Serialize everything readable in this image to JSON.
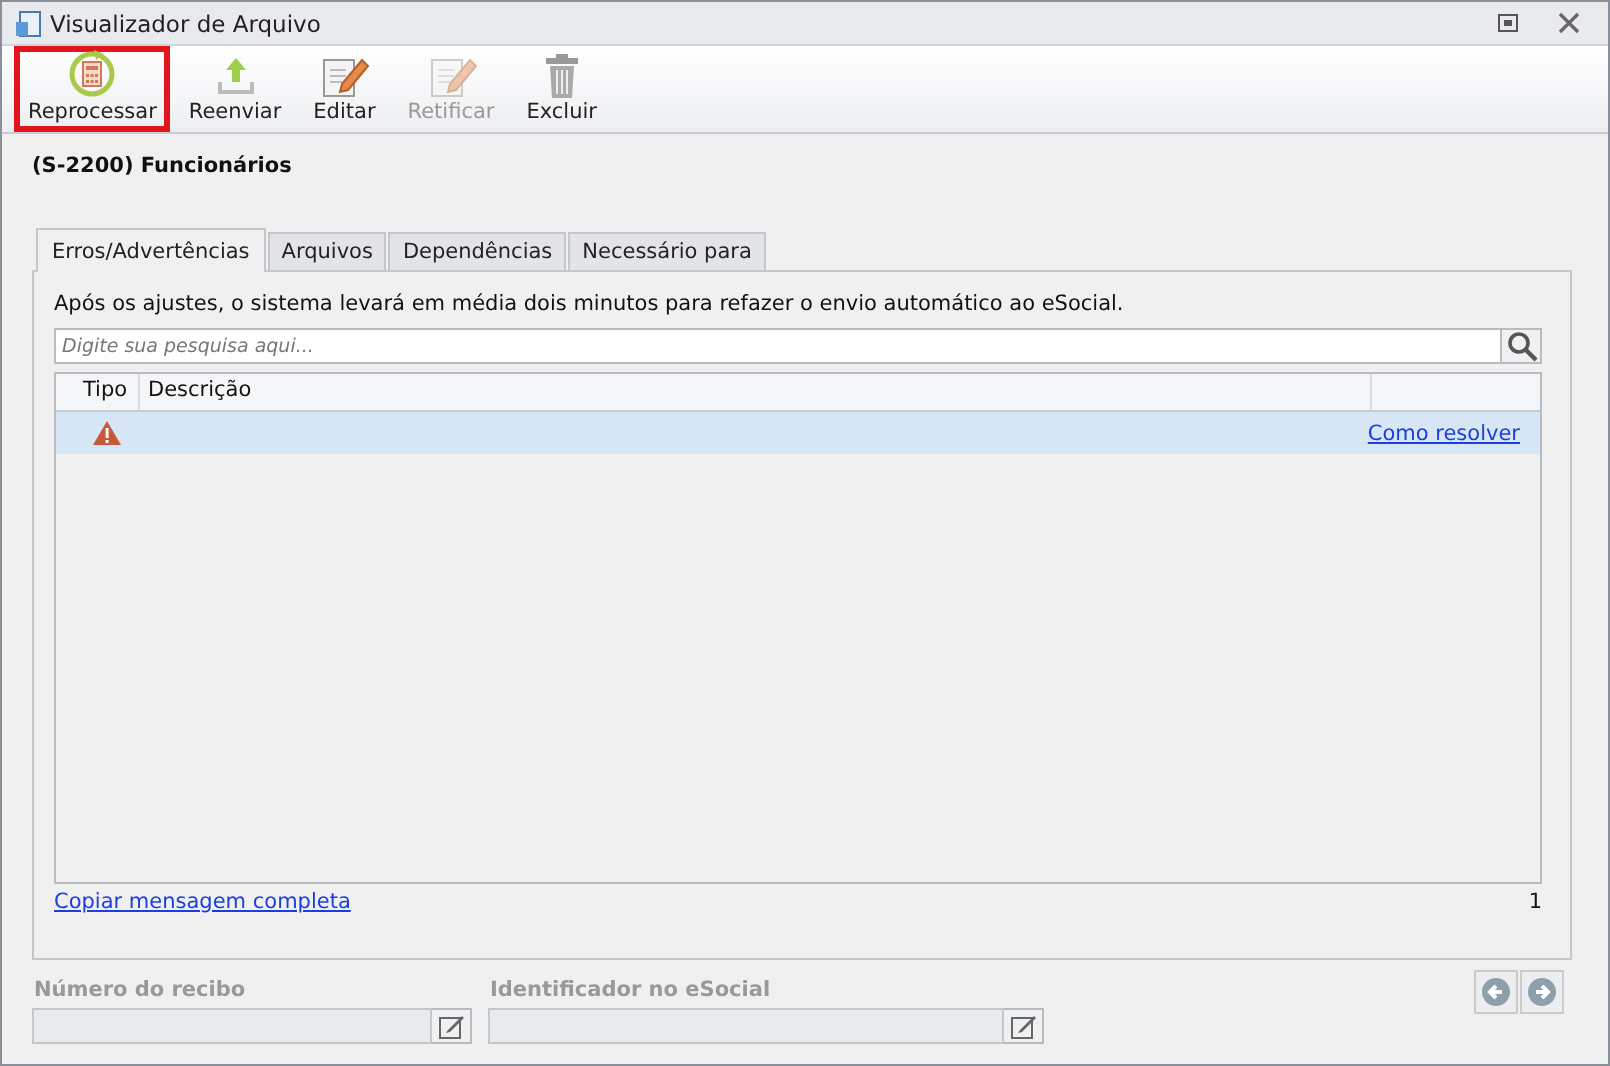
{
  "window": {
    "title": "Visualizador de Arquivo"
  },
  "toolbar": [
    {
      "label": "Reprocessar",
      "kind": "recalc",
      "disabled": false,
      "highlighted": true
    },
    {
      "label": "Reenviar",
      "kind": "upload",
      "disabled": false,
      "highlighted": false
    },
    {
      "label": "Editar",
      "kind": "edit",
      "disabled": false,
      "highlighted": false
    },
    {
      "label": "Retificar",
      "kind": "edit",
      "disabled": true,
      "highlighted": false
    },
    {
      "label": "Excluir",
      "kind": "trash",
      "disabled": false,
      "highlighted": false
    }
  ],
  "heading": "(S-2200) Funcionários",
  "tabs": [
    {
      "label": "Erros/Advertências",
      "selected": true
    },
    {
      "label": "Arquivos",
      "selected": false
    },
    {
      "label": "Dependências",
      "selected": false
    },
    {
      "label": "Necessário para",
      "selected": false
    }
  ],
  "notice": "Após os ajustes, o sistema levará em média dois minutos para refazer o envio automático ao eSocial.",
  "search": {
    "placeholder": "Digite sua pesquisa aqui..."
  },
  "table": {
    "columns": [
      "Tipo",
      "Descrição"
    ],
    "rows": [
      {
        "kind": "warning",
        "selected": true,
        "link": "Como resolver"
      }
    ]
  },
  "copy_link": "Copiar mensagem completa",
  "count": "1",
  "fields": [
    {
      "label": "Número do recibo",
      "disabled": true
    },
    {
      "label": "Identificador no eSocial",
      "disabled": true
    }
  ]
}
